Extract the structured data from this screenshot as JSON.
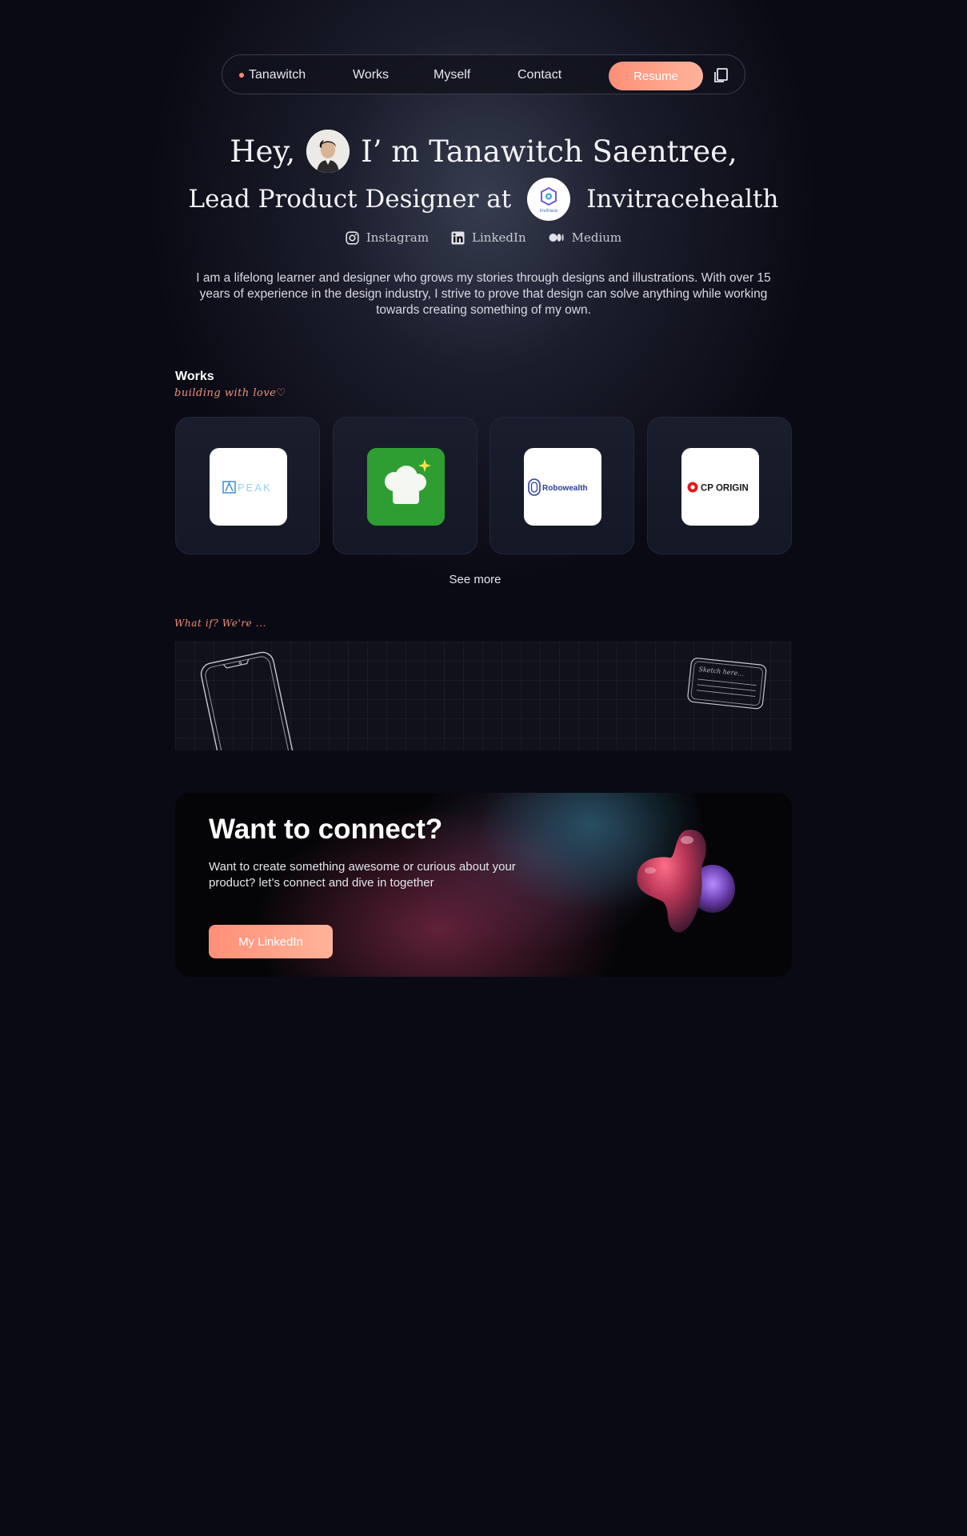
{
  "nav": {
    "brand": "Tanawitch",
    "items": [
      "Works",
      "Myself",
      "Contact"
    ],
    "resume_label": "Resume",
    "copy_icon": "copy-icon"
  },
  "hero": {
    "hey": "Hey,",
    "intro": "I’ m Tanawitch Saentree,",
    "role": "Lead Product Designer at",
    "company": "Invitracehealth",
    "company_logo_text": "invitrace"
  },
  "socials": [
    {
      "label": "Instagram",
      "icon": "instagram-icon"
    },
    {
      "label": "LinkedIn",
      "icon": "linkedin-icon"
    },
    {
      "label": "Medium",
      "icon": "medium-icon"
    }
  ],
  "bio": "I am a lifelong learner and designer who grows my stories through designs and illustrations. With over 15 years of experience in the design industry, I strive to prove that design can solve anything while working towards creating something of my own.",
  "works": {
    "title": "Works",
    "subtitle": "building with love♡",
    "projects": [
      {
        "logo_text": "PEAK"
      },
      {
        "logo_text": ""
      },
      {
        "logo_text": "Robowealth"
      },
      {
        "logo_text": "CP ORIGIN"
      }
    ],
    "see_more": "See more"
  },
  "whatif": {
    "label": "What if? We're ...",
    "sketch_note": "Sketch here..."
  },
  "connect": {
    "title": "Want to connect?",
    "text": "Want to create something awesome or curious about your product? let’s connect and dive in together",
    "button": "My LinkedIn"
  },
  "colors": {
    "accent": "#ff8f78",
    "accent_light": "#ffb39a",
    "background": "#0a0a14",
    "script_text": "#f08f7a"
  }
}
